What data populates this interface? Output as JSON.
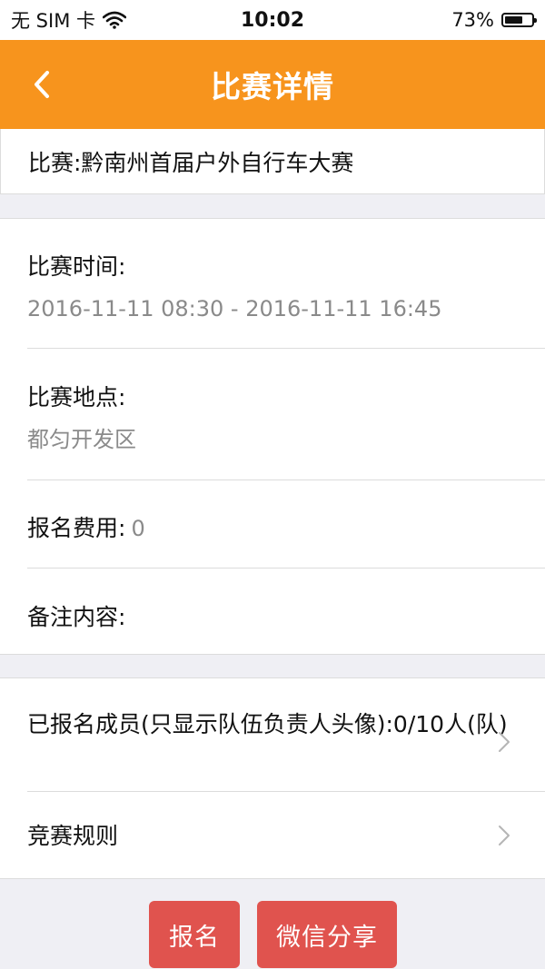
{
  "status_bar": {
    "carrier": "无 SIM 卡",
    "time": "10:02",
    "battery_pct": "73%",
    "battery_level": 0.73
  },
  "nav": {
    "title": "比赛详情",
    "back_icon": "chevron-left-icon"
  },
  "match": {
    "title_text": "比赛:黔南州首届户外自行车大赛"
  },
  "details": {
    "time_label": "比赛时间:",
    "time_value": "2016-11-11 08:30 - 2016-11-11 16:45",
    "location_label": "比赛地点:",
    "location_value": "都匀开发区",
    "fee_label": "报名费用:",
    "fee_value": "0",
    "remarks_label": "备注内容:"
  },
  "links": {
    "members_text": "已报名成员(只显示队伍负责人头像):0/10人(队)",
    "rules_text": "竞赛规则",
    "chevron_icon": "chevron-right-icon"
  },
  "buttons": {
    "signup_label": "报名",
    "share_label": "微信分享"
  },
  "colors": {
    "nav_bg": "#f7941d",
    "button_bg": "#e0534e",
    "page_bg": "#efeff4"
  }
}
